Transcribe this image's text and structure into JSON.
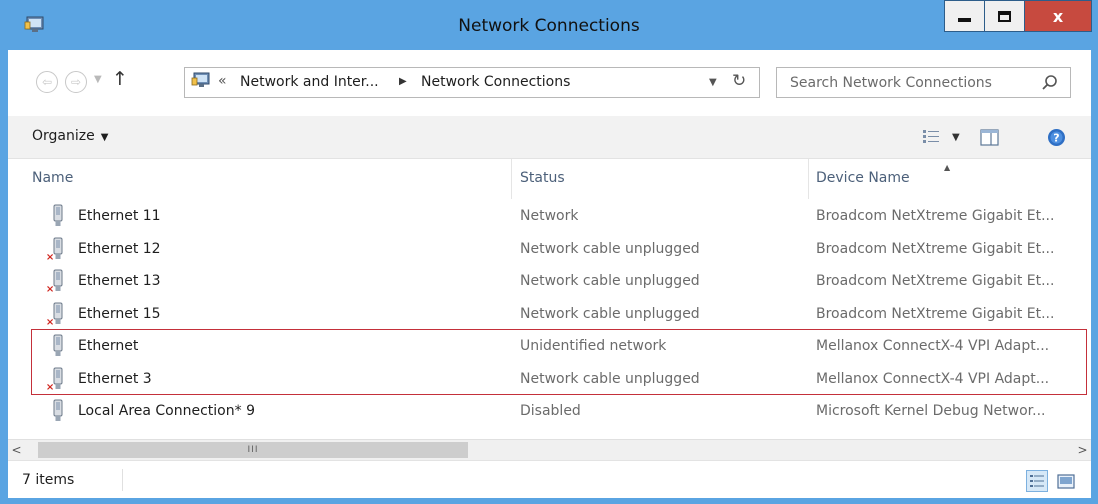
{
  "window": {
    "title": "Network Connections",
    "minimize_icon": "minimize-icon",
    "maximize_icon": "maximize-icon",
    "close_glyph": "x",
    "colors": {
      "titlebar": "#5aa4e2",
      "close": "#c74a3f",
      "highlight_border": "#c4303a"
    }
  },
  "navigation": {
    "back_glyph": "⇦",
    "forward_glyph": "⇨",
    "up_glyph": "↑",
    "breadcrumb_overflow": "«",
    "breadcrumb": [
      "Network and Inter...",
      "Network Connections"
    ],
    "breadcrumb_separator": "▶",
    "search_placeholder": "Search Network Connections"
  },
  "toolbar": {
    "organize_label": "Organize",
    "organize_caret": "▼",
    "views_caret": "▼"
  },
  "columns": [
    "Name",
    "Status",
    "Device Name"
  ],
  "sort_indicator": "▲",
  "rows": [
    {
      "name": "Ethernet 11",
      "status": "Network",
      "device": "Broadcom NetXtreme Gigabit Et...",
      "disconnected": false
    },
    {
      "name": "Ethernet 12",
      "status": "Network cable unplugged",
      "device": "Broadcom NetXtreme Gigabit Et...",
      "disconnected": true
    },
    {
      "name": "Ethernet 13",
      "status": "Network cable unplugged",
      "device": "Broadcom NetXtreme Gigabit Et...",
      "disconnected": true
    },
    {
      "name": "Ethernet 15",
      "status": "Network cable unplugged",
      "device": "Broadcom NetXtreme Gigabit Et...",
      "disconnected": true
    },
    {
      "name": "Ethernet",
      "status": "Unidentified network",
      "device": "Mellanox ConnectX-4 VPI Adapt...",
      "disconnected": false,
      "highlighted": true
    },
    {
      "name": "Ethernet 3",
      "status": "Network cable unplugged",
      "device": "Mellanox ConnectX-4 VPI Adapt...",
      "disconnected": true,
      "highlighted": true
    },
    {
      "name": "Local Area Connection* 9",
      "status": "Disabled",
      "device": "Microsoft Kernel Debug Networ...",
      "disconnected": false
    }
  ],
  "scrollbar": {
    "left_glyph": "<",
    "right_glyph": ">",
    "grip": "III"
  },
  "status": {
    "item_count": "7 items"
  }
}
